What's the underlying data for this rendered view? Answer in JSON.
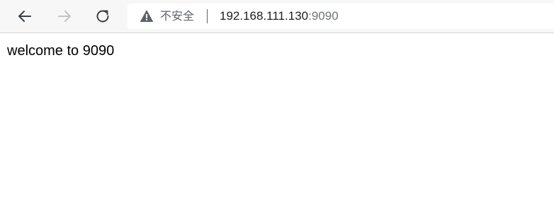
{
  "toolbar": {
    "back_icon": "arrow-left-icon",
    "forward_icon": "arrow-right-icon",
    "reload_icon": "reload-icon"
  },
  "omnibox": {
    "security_icon": "warning-triangle-icon",
    "security_label": "不安全",
    "host": "192.168.111.130",
    "port": ":9090"
  },
  "page": {
    "body_text": "welcome to 9090"
  },
  "colors": {
    "toolbar_bg": "#f7f7f7",
    "omnibox_bg": "#ffffff",
    "icon_active": "#3c4043",
    "icon_disabled": "#c4c4c4",
    "security_text": "#5f6368",
    "url_text": "#202124",
    "port_text": "#70757a"
  }
}
